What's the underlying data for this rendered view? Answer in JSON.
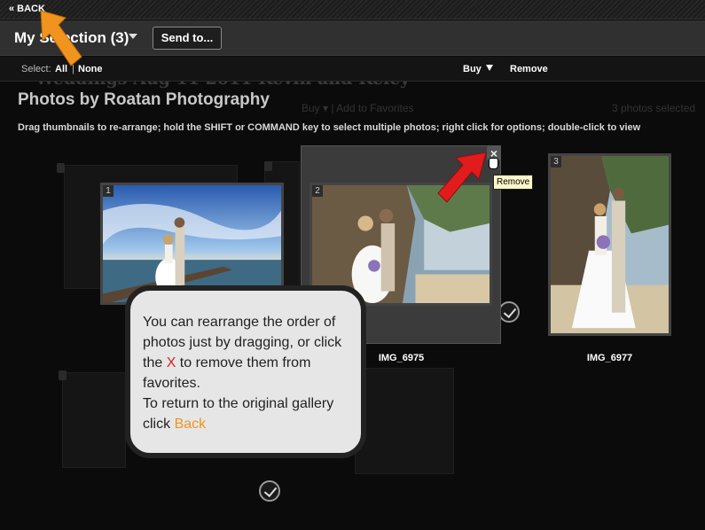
{
  "back_bar": {
    "back_label": "« BACK"
  },
  "title_bar": {
    "selection_title": "My Selection (3)",
    "send_button": "Send to..."
  },
  "toolbar": {
    "select_label": "Select:",
    "all": "All",
    "separator": "|",
    "none": "None",
    "buy": "Buy",
    "remove": "Remove"
  },
  "background": {
    "gallery_title": "Weddings Aug 11 2011 Kevin and Kelcy",
    "toolbar_text": "Buy ▾  |  Add to Favorites",
    "count_text": "3 photos selected"
  },
  "gallery": {
    "heading": "Photos by Roatan Photography",
    "instructions": "Drag thumbnails to re-arrange; hold the SHIFT or COMMAND key to select multiple photos; right click for options; double-click to view"
  },
  "photos": [
    {
      "number": "1",
      "caption": ""
    },
    {
      "number": "2",
      "caption": "IMG_6975"
    },
    {
      "number": "3",
      "caption": "IMG_6977"
    }
  ],
  "tooltip": {
    "text": "Remove"
  },
  "callout": {
    "line1": "You can rearrange the order of photos just by dragging, or click the ",
    "x": "X",
    "line2": " to remove them from favorites.",
    "line3": "To return to the original gallery click ",
    "back": "Back"
  },
  "colors": {
    "arrow_orange": "#f0941d",
    "arrow_red": "#e01c1c",
    "panel": "#3b3b3b"
  },
  "icons": [
    "lock-icon",
    "checkmark-icon",
    "close-icon",
    "hand-cursor-icon",
    "caret-down-icon"
  ]
}
